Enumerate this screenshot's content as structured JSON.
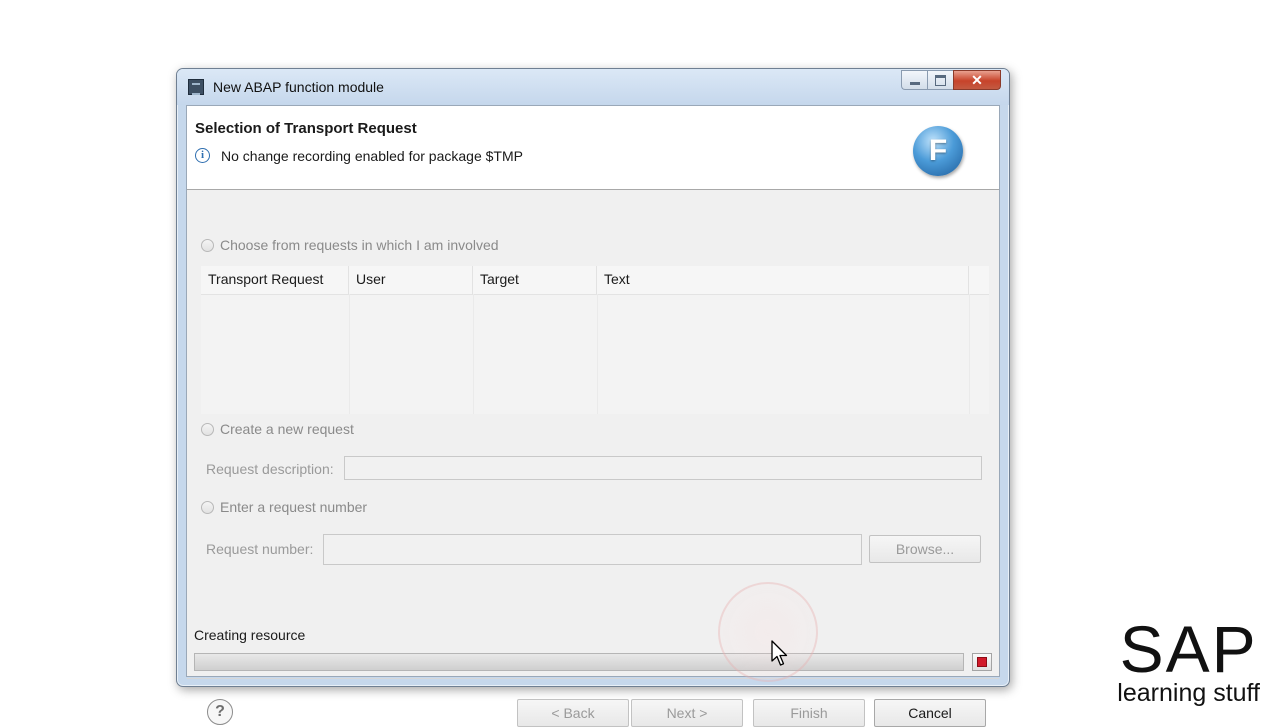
{
  "window": {
    "title": "New ABAP function module",
    "caption_buttons": {
      "close_label": "✕"
    }
  },
  "header": {
    "title": "Selection of Transport Request",
    "info_message": "No change recording enabled for package $TMP",
    "wizard_icon_letter": "F"
  },
  "options": {
    "choose_label": "Choose from requests in which I am involved",
    "create_label": "Create a new request",
    "enter_label": "Enter a request number"
  },
  "table": {
    "columns": [
      "Transport Request",
      "User",
      "Target",
      "Text"
    ],
    "rows": []
  },
  "fields": {
    "request_description_label": "Request description:",
    "request_description_value": "",
    "request_number_label": "Request number:",
    "request_number_value": "",
    "browse_label": "Browse..."
  },
  "progress": {
    "label": "Creating resource",
    "value": 1.0
  },
  "footer": {
    "help_icon": "?",
    "back_label": "< Back",
    "next_label": "Next >",
    "finish_label": "Finish",
    "cancel_label": "Cancel"
  },
  "brand": {
    "logo_text": "SAP",
    "logo_subtext": "learning stuff"
  },
  "colors": {
    "stop_button": "#d11a2a",
    "wizard_icon": "#2f7cc4",
    "info_icon": "#2f6fb0"
  },
  "icons": [
    "app-window-icon",
    "info-icon",
    "wizard-function-icon",
    "help-icon",
    "stop-icon",
    "mouse-cursor-icon"
  ]
}
